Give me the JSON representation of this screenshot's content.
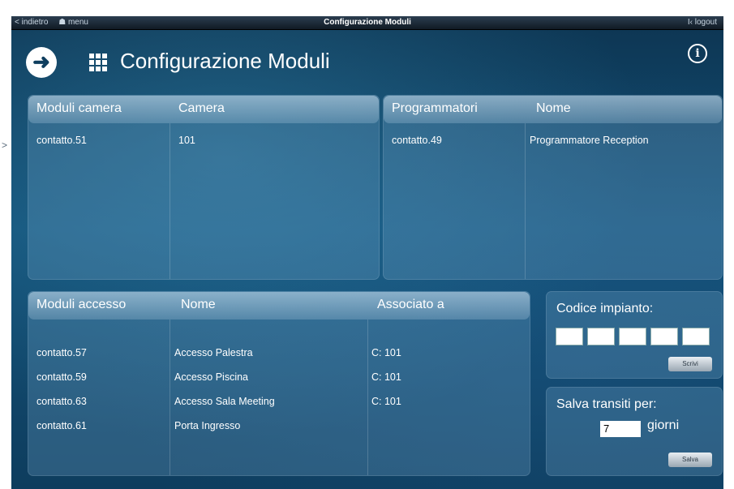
{
  "topbar": {
    "back_label": "< indietro",
    "menu_label": "☗ menu",
    "title": "Configurazione Moduli",
    "logout_label": "I‹ logout"
  },
  "header": {
    "title": "Configurazione Moduli",
    "back_icon": "arrow-left-icon",
    "grid_icon": "grid-icon",
    "info_icon": "info-icon"
  },
  "camera_panel": {
    "headers": [
      "Moduli camera",
      "Camera"
    ],
    "rows": [
      {
        "modulo": "contatto.51",
        "camera": "101"
      }
    ]
  },
  "programmatori_panel": {
    "headers": [
      "Programmatori",
      "Nome"
    ],
    "rows": [
      {
        "modulo": "contatto.49",
        "nome": "Programmatore Reception"
      }
    ]
  },
  "accesso_panel": {
    "headers": [
      "Moduli accesso",
      "Nome",
      "Associato a"
    ],
    "rows": [
      {
        "modulo": "contatto.57",
        "nome": "Accesso Palestra",
        "associato": "C: 101"
      },
      {
        "modulo": "contatto.59",
        "nome": "Accesso Piscina",
        "associato": "C: 101"
      },
      {
        "modulo": "contatto.63",
        "nome": "Accesso Sala Meeting",
        "associato": "C: 101"
      },
      {
        "modulo": "contatto.61",
        "nome": "Porta Ingresso",
        "associato": ""
      }
    ]
  },
  "codice_panel": {
    "title": "Codice impianto:",
    "button_label": "Scrivi"
  },
  "transiti_panel": {
    "title": "Salva transiti per:",
    "days_value": "7",
    "days_label": "giorni",
    "button_label": "Salva"
  },
  "colors": {
    "background_dark": "#0d3552",
    "background_mid": "#135178",
    "text": "#ffffff"
  }
}
